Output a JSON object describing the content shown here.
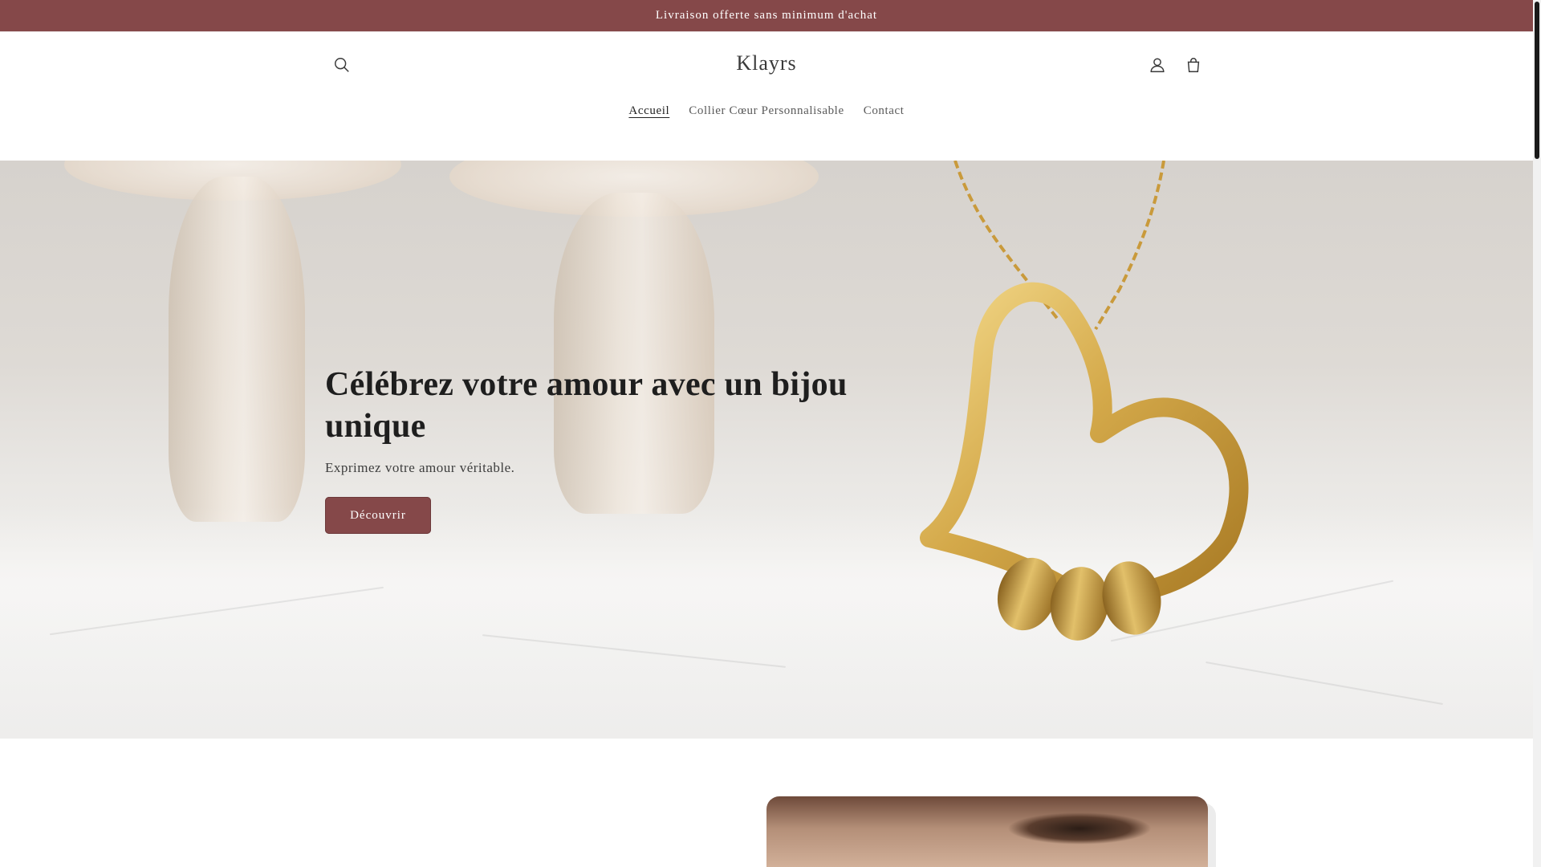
{
  "announcement": {
    "text": "Livraison offerte sans minimum d'achat"
  },
  "header": {
    "logo": "Klayrs",
    "icons": {
      "search": "search-icon",
      "account": "user-icon",
      "cart": "cart-icon"
    }
  },
  "nav": {
    "items": [
      {
        "label": "Accueil",
        "active": true
      },
      {
        "label": "Collier Cœur Personnalisable",
        "active": false
      },
      {
        "label": "Contact",
        "active": false
      }
    ]
  },
  "hero": {
    "title": "Célébrez votre amour avec un bijou unique",
    "subtitle": "Exprimez votre amour véritable.",
    "button_label": "Découvrir"
  },
  "colors": {
    "brand": "#854849",
    "text": "#121212",
    "background": "#ffffff"
  }
}
